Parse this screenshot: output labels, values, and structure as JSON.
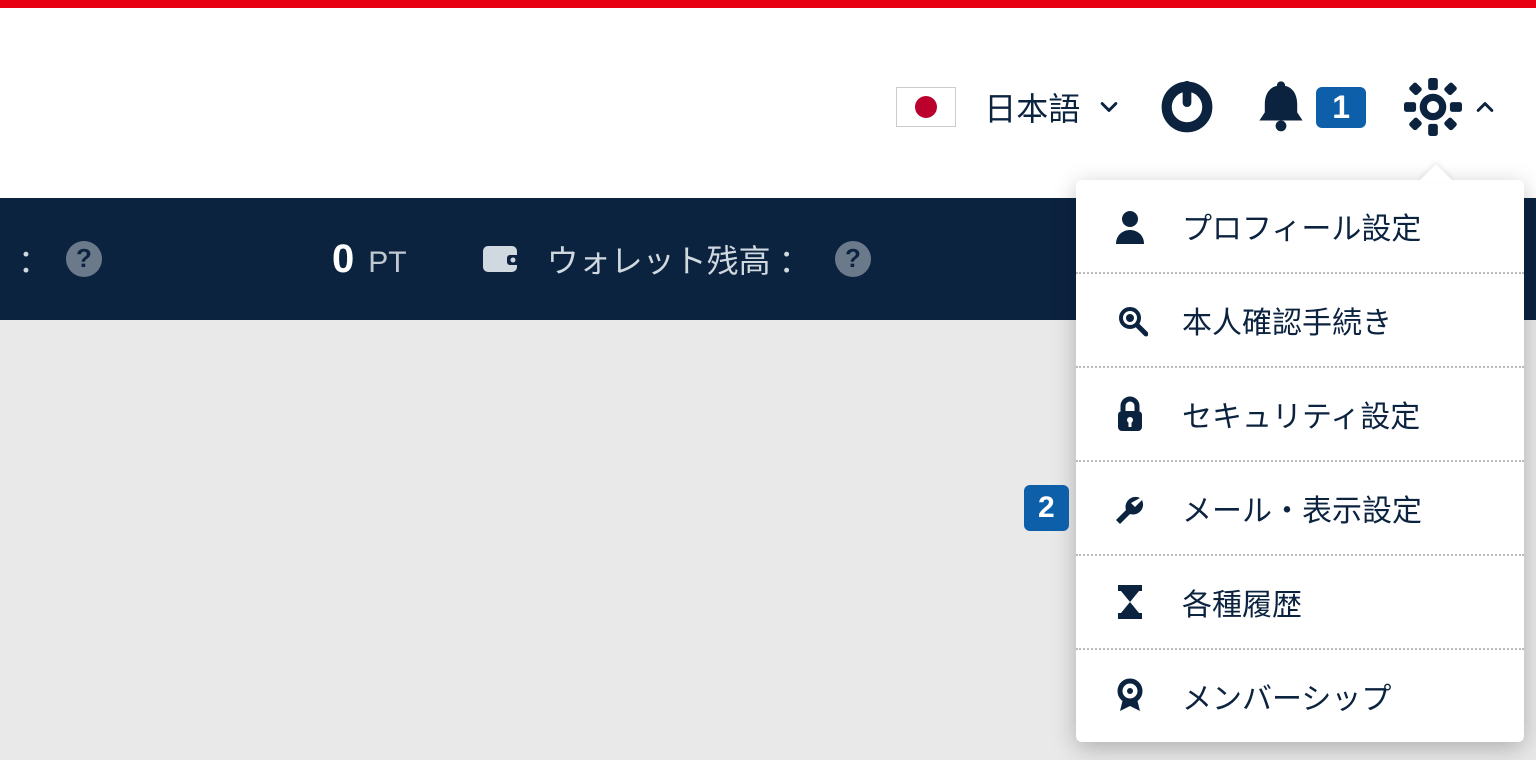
{
  "accent_color": "#e60012",
  "dark_navy": "#0c2340",
  "badge_blue": "#0c5fa8",
  "language": {
    "label": "日本語",
    "flag": "japan"
  },
  "notifications": {
    "count": "1"
  },
  "status_bar": {
    "leading_colon": "：",
    "points_value": "0",
    "points_unit": "PT",
    "wallet_label": "ウォレット残高",
    "wallet_colon": "："
  },
  "menu": [
    {
      "icon": "user",
      "label": "プロフィール設定"
    },
    {
      "icon": "identity",
      "label": "本人確認手続き"
    },
    {
      "icon": "lock",
      "label": "セキュリティ設定"
    },
    {
      "icon": "wrench",
      "label": "メール・表示設定",
      "badge": "2"
    },
    {
      "icon": "hourglass",
      "label": "各種履歴"
    },
    {
      "icon": "award",
      "label": "メンバーシップ"
    }
  ]
}
